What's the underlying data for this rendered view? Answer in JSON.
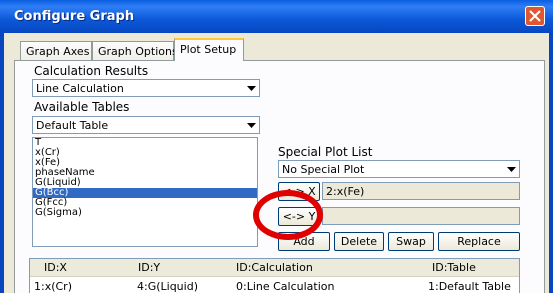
{
  "window": {
    "title": "Configure Graph"
  },
  "tabs": [
    {
      "label": "Graph Axes",
      "active": false
    },
    {
      "label": "Graph Options",
      "active": false
    },
    {
      "label": "Plot Setup",
      "active": true
    }
  ],
  "calculation_results": {
    "label": "Calculation Results",
    "value": "Line Calculation"
  },
  "available_tables": {
    "label": "Available Tables",
    "value": "Default Table",
    "items": [
      "T",
      "x(Cr)",
      "x(Fe)",
      "phaseName",
      "G(Liquid)",
      "G(Bcc)",
      "G(Fcc)",
      "G(Sigma)"
    ],
    "selected_index": 5
  },
  "special_plot_list": {
    "label": "Special Plot List",
    "value": "No Special Plot"
  },
  "x_row": {
    "button_label": "<-> X",
    "value": "2:x(Fe)"
  },
  "y_row": {
    "button_label": "<-> Y",
    "value": ""
  },
  "actions": {
    "add": "Add",
    "delete": "Delete",
    "swap": "Swap",
    "replace": "Replace"
  },
  "plot_table": {
    "columns": [
      "ID:X",
      "ID:Y",
      "ID:Calculation",
      "ID:Table"
    ],
    "rows": [
      [
        "1:x(Cr)",
        "4:G(Liquid)",
        "0:Line Calculation",
        "1:Default Table"
      ]
    ]
  },
  "annotation": {
    "color": "#e00000"
  }
}
